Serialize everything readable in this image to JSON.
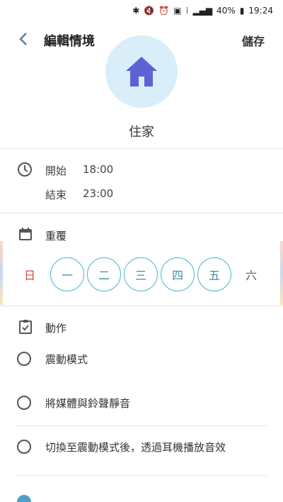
{
  "status_bar": {
    "battery": "40%",
    "time": "19:24",
    "icons": [
      "bluetooth-icon",
      "mute-icon",
      "alarm-icon",
      "nfc-icon",
      "sim-icon",
      "signal-icon",
      "battery-icon"
    ]
  },
  "header": {
    "title": "編輯情境",
    "save_label": "儲存"
  },
  "profile": {
    "name": "住家",
    "icon": "home-icon"
  },
  "schedule": {
    "start_label": "開始",
    "start_time": "18:00",
    "end_label": "結束",
    "end_time": "23:00"
  },
  "repeat": {
    "label": "重覆",
    "days": [
      {
        "label": "日",
        "selected": false
      },
      {
        "label": "一",
        "selected": true
      },
      {
        "label": "二",
        "selected": true
      },
      {
        "label": "三",
        "selected": true
      },
      {
        "label": "四",
        "selected": true
      },
      {
        "label": "五",
        "selected": true
      },
      {
        "label": "六",
        "selected": false
      }
    ]
  },
  "actions": {
    "label": "動作",
    "items": [
      {
        "label": "震動模式",
        "checked": false
      },
      {
        "label": "將媒體與鈴聲靜音",
        "checked": false
      },
      {
        "label": "切換至震動模式後，透過耳機播放音效",
        "checked": false
      }
    ]
  },
  "colors": {
    "accent": "#47b4c9",
    "sunday": "#d54a3a",
    "home_icon": "#5b62d6"
  }
}
